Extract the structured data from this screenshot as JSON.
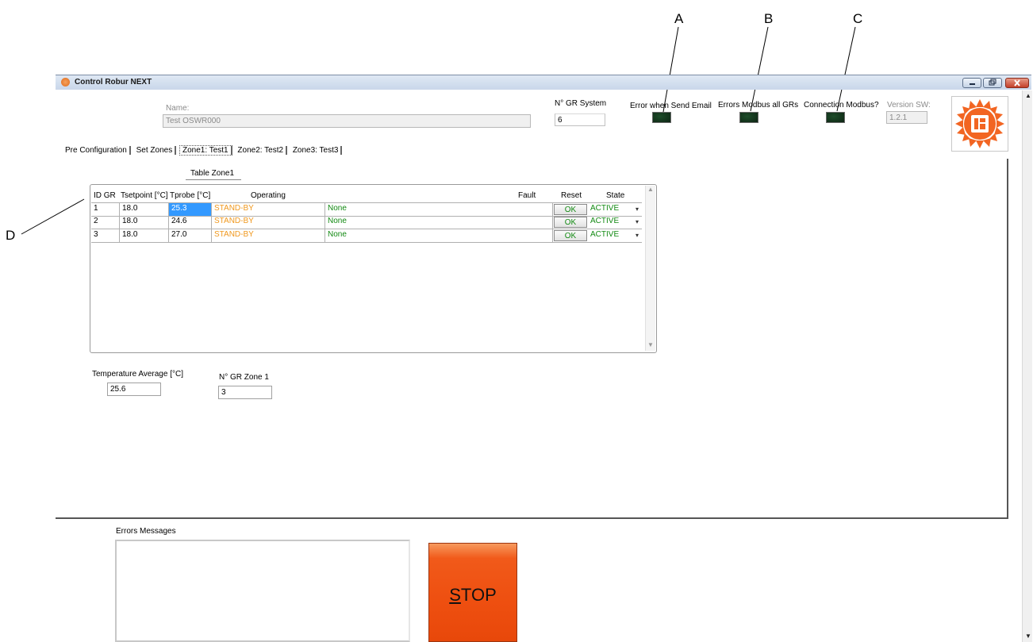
{
  "callouts": {
    "a": "A",
    "b": "B",
    "c": "C",
    "d": "D"
  },
  "window": {
    "title": "Control Robur NEXT"
  },
  "header": {
    "name_label": "Name:",
    "name_value": "Test OSWR000",
    "gr_system_label": "N° GR System",
    "gr_system_value": "6",
    "email_error_label": "Error when Send Email",
    "modbus_errors_label": "Errors Modbus all GRs",
    "connection_label": "Connection Modbus?",
    "version_label": "Version SW:",
    "version_value": "1.2.1"
  },
  "tabs": [
    "Pre Configuration",
    "Set Zones",
    "Zone1: Test1",
    "Zone2: Test2",
    "Zone3: Test3"
  ],
  "table": {
    "caption": "Table Zone1",
    "headers": [
      "ID GR",
      "Tsetpoint [°C]",
      "Tprobe [°C]",
      "Operating",
      "Fault",
      "Reset",
      "State"
    ],
    "rows": [
      {
        "id": "1",
        "setpoint": "18.0",
        "probe": "25.3",
        "operating": "STAND-BY",
        "fault": "None",
        "reset": "OK",
        "state": "ACTIVE"
      },
      {
        "id": "2",
        "setpoint": "18.0",
        "probe": "24.6",
        "operating": "STAND-BY",
        "fault": "None",
        "reset": "OK",
        "state": "ACTIVE"
      },
      {
        "id": "3",
        "setpoint": "18.0",
        "probe": "27.0",
        "operating": "STAND-BY",
        "fault": "None",
        "reset": "OK",
        "state": "ACTIVE"
      }
    ]
  },
  "zone_info": {
    "temp_avg_label": "Temperature Average [°C]",
    "temp_avg_value": "25.6",
    "gr_zone_label": "N° GR Zone 1",
    "gr_zone_value": "3"
  },
  "errors": {
    "label": "Errors Messages"
  },
  "stop": {
    "label": "STOP"
  },
  "colors": {
    "stop": "#ee4f10",
    "operating": "#f0981e",
    "ok_green": "#138a13",
    "led": "#0d2413",
    "logo": "#f26522"
  }
}
